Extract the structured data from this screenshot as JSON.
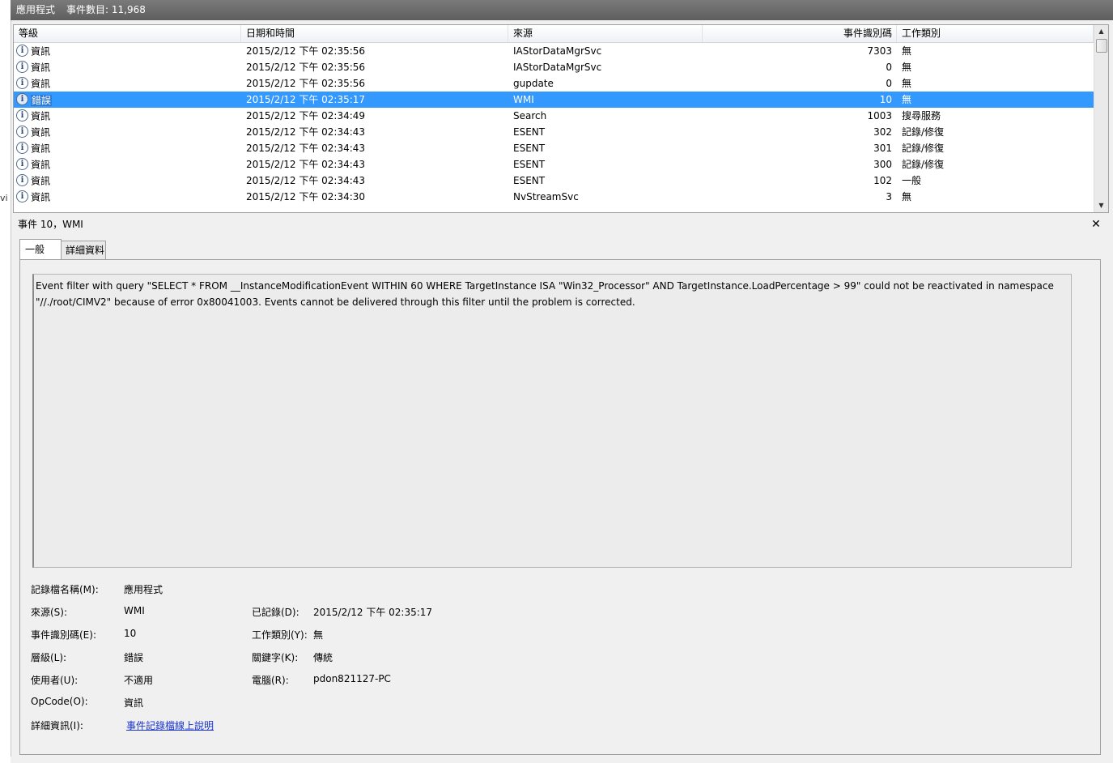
{
  "window": {
    "title": "應用程式",
    "event_count": "事件數目: 11,968",
    "left_edge_char": "vi"
  },
  "list": {
    "columns": {
      "level": "等級",
      "datetime": "日期和時間",
      "source": "來源",
      "event_id": "事件識別碼",
      "task": "工作類別"
    },
    "rows": [
      {
        "level": "資訊",
        "datetime": "2015/2/12 下午 02:35:56",
        "source": "IAStorDataMgrSvc",
        "event_id": "7303",
        "task": "無"
      },
      {
        "level": "資訊",
        "datetime": "2015/2/12 下午 02:35:56",
        "source": "IAStorDataMgrSvc",
        "event_id": "0",
        "task": "無"
      },
      {
        "level": "資訊",
        "datetime": "2015/2/12 下午 02:35:56",
        "source": "gupdate",
        "event_id": "0",
        "task": "無"
      },
      {
        "level": "錯誤",
        "datetime": "2015/2/12 下午 02:35:17",
        "source": "WMI",
        "event_id": "10",
        "task": "無"
      },
      {
        "level": "資訊",
        "datetime": "2015/2/12 下午 02:34:49",
        "source": "Search",
        "event_id": "1003",
        "task": "搜尋服務"
      },
      {
        "level": "資訊",
        "datetime": "2015/2/12 下午 02:34:43",
        "source": "ESENT",
        "event_id": "302",
        "task": "記錄/修復"
      },
      {
        "level": "資訊",
        "datetime": "2015/2/12 下午 02:34:43",
        "source": "ESENT",
        "event_id": "301",
        "task": "記錄/修復"
      },
      {
        "level": "資訊",
        "datetime": "2015/2/12 下午 02:34:43",
        "source": "ESENT",
        "event_id": "300",
        "task": "記錄/修復"
      },
      {
        "level": "資訊",
        "datetime": "2015/2/12 下午 02:34:43",
        "source": "ESENT",
        "event_id": "102",
        "task": "一般"
      },
      {
        "level": "資訊",
        "datetime": "2015/2/12 下午 02:34:30",
        "source": "NvStreamSvc",
        "event_id": "3",
        "task": "無"
      }
    ]
  },
  "detail": {
    "header": "事件 10，WMI",
    "close_symbol": "✕",
    "tabs": [
      "一般",
      "詳細資料"
    ],
    "description": "Event filter with query \"SELECT * FROM __InstanceModificationEvent WITHIN 60 WHERE TargetInstance ISA \"Win32_Processor\" AND TargetInstance.LoadPercentage > 99\" could not be reactivated in namespace \"//./root/CIMV2\" because of error 0x80041003. Events cannot be delivered through this filter until the problem is corrected.",
    "fields": {
      "log_name_label": "記錄檔名稱(M):",
      "log_name": "應用程式",
      "source_label": "來源(S):",
      "source": "WMI",
      "logged_label": "已記錄(D):",
      "logged": "2015/2/12 下午 02:35:17",
      "event_id_label": "事件識別碼(E):",
      "event_id": "10",
      "task_label": "工作類別(Y):",
      "task": "無",
      "level_label": "層級(L):",
      "level": "錯誤",
      "keywords_label": "關鍵字(K):",
      "keywords": "傳統",
      "user_label": "使用者(U):",
      "user": "不適用",
      "computer_label": "電腦(R):",
      "computer": "pdon821127-PC",
      "opcode_label": "OpCode(O):",
      "opcode": "資訊",
      "more_info_label": "詳細資訊(I):",
      "more_info_link": "事件記錄檔線上說明"
    }
  }
}
